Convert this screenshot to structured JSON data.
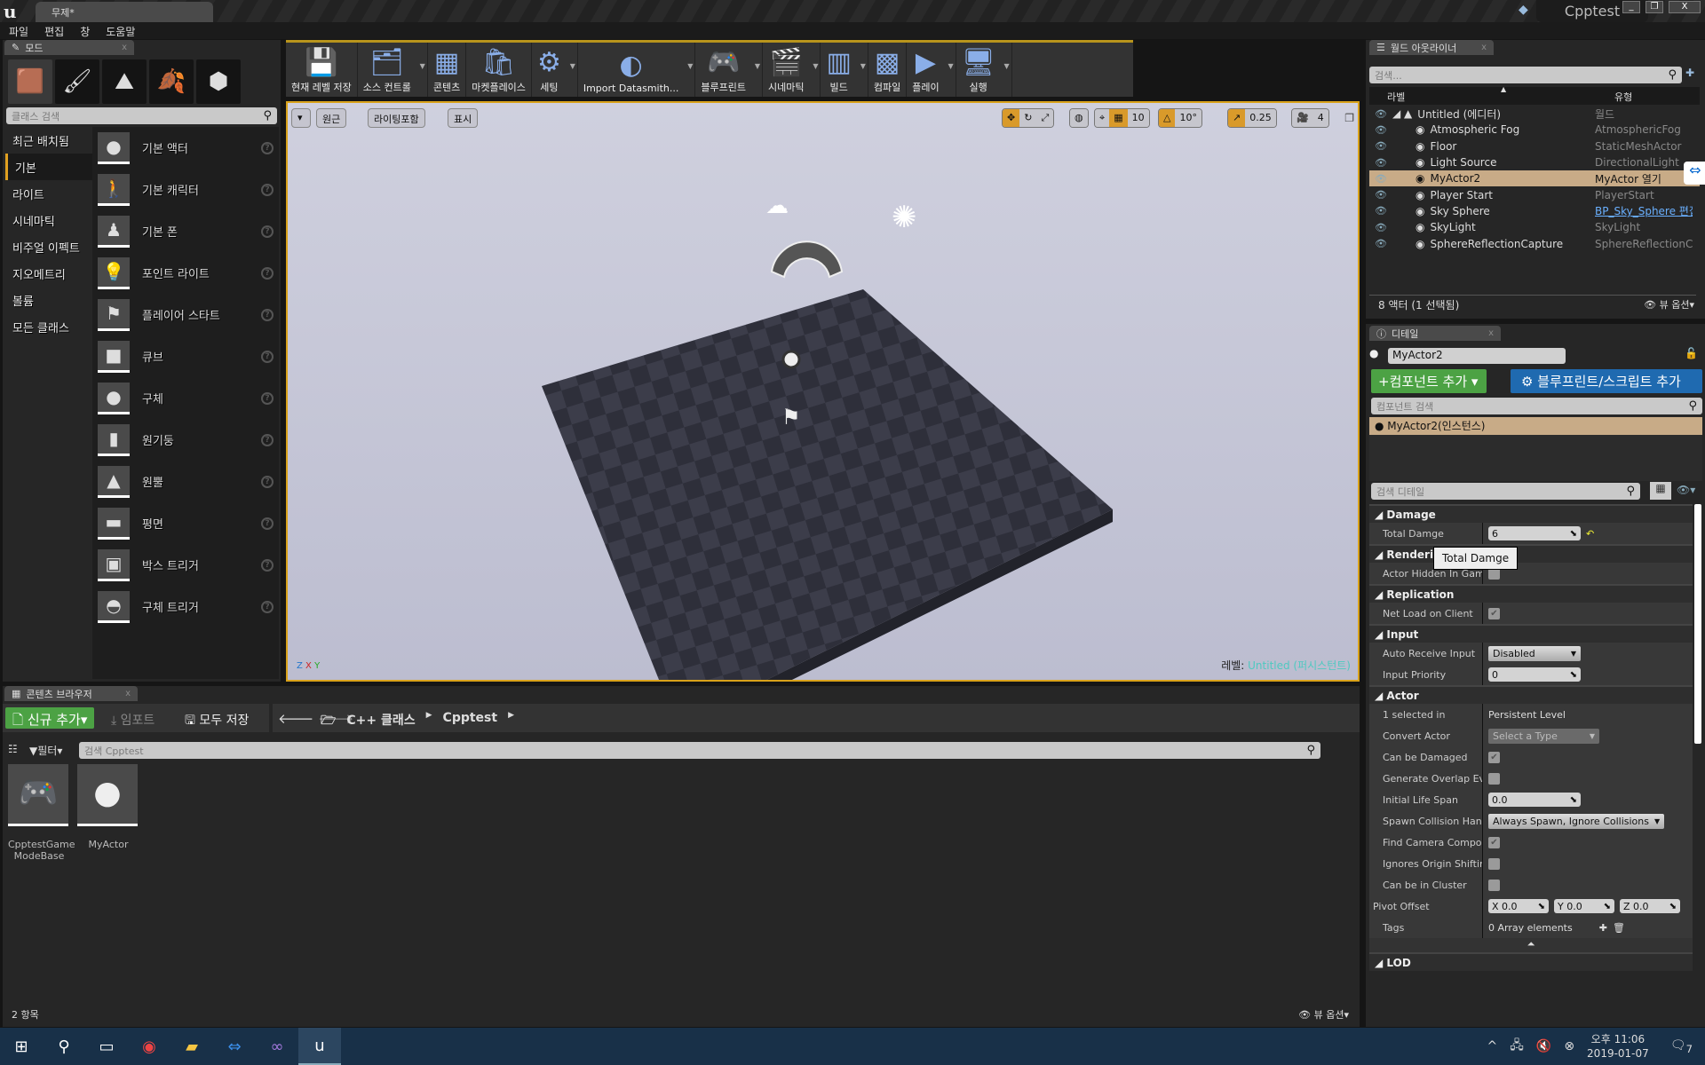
{
  "window": {
    "doc_tab": "무제*",
    "project": "Cpptest",
    "controls": [
      "_",
      "❐",
      "X"
    ]
  },
  "menu": [
    "파일",
    "편집",
    "창",
    "도움말"
  ],
  "modes": {
    "tab": "모드",
    "icons": [
      "place-mode",
      "paint-mode",
      "landscape-mode",
      "foliage-mode",
      "geometry-mode"
    ],
    "search_placeholder": "클래스 검색",
    "categories": [
      "최근 배치됨",
      "기본",
      "라이트",
      "시네마틱",
      "비주얼 이펙트",
      "지오메트리",
      "볼륨",
      "모든 클래스"
    ],
    "active_category": "기본",
    "items": [
      "기본 액터",
      "기본 캐릭터",
      "기본 폰",
      "포인트 라이트",
      "플레이어 스타트",
      "큐브",
      "구체",
      "원기둥",
      "원뿔",
      "평면",
      "박스 트리거",
      "구체 트리거"
    ]
  },
  "toolbar": [
    {
      "label": "현재 레벨 저장",
      "icon": "save-icon"
    },
    {
      "label": "소스 컨트롤",
      "icon": "source-control-icon",
      "dropdown": true
    },
    {
      "label": "콘텐츠",
      "icon": "content-icon"
    },
    {
      "label": "마켓플레이스",
      "icon": "marketplace-icon"
    },
    {
      "label": "세팅",
      "icon": "settings-icon",
      "dropdown": true
    },
    {
      "label": "Import Datasmith...",
      "icon": "datasmith-icon",
      "dropdown": true
    },
    {
      "label": "블루프린트",
      "icon": "blueprint-icon",
      "dropdown": true
    },
    {
      "label": "시네마틱",
      "icon": "cinematic-icon",
      "dropdown": true
    },
    {
      "label": "빌드",
      "icon": "build-icon",
      "dropdown": true
    },
    {
      "label": "컴파일",
      "icon": "compile-icon"
    },
    {
      "label": "플레이",
      "icon": "play-icon",
      "dropdown": true
    },
    {
      "label": "실행",
      "icon": "launch-icon",
      "dropdown": true
    }
  ],
  "viewport": {
    "perspective": "원근",
    "lighting": "라이팅포함",
    "show": "표시",
    "grid_snap": "10",
    "rotation_snap": "10°",
    "scale_snap": "0.25",
    "camera_speed": "4",
    "level_label": "레벨:",
    "level_name": "Untitled (퍼시스턴트)",
    "axis": [
      "Z",
      "X",
      "Y"
    ]
  },
  "outliner": {
    "tab": "월드 아웃라이너",
    "search_placeholder": "검색...",
    "col_label": "라벨",
    "col_type": "유형",
    "rows": [
      {
        "name": "Untitled (에디터)",
        "type": "월드"
      },
      {
        "name": "Atmospheric Fog",
        "type": "AtmosphericFog"
      },
      {
        "name": "Floor",
        "type": "StaticMeshActor"
      },
      {
        "name": "Light Source",
        "type": "DirectionalLight"
      },
      {
        "name": "MyActor2",
        "type": "MyActor 열기",
        "selected": true
      },
      {
        "name": "Player Start",
        "type": "PlayerStart"
      },
      {
        "name": "Sky Sphere",
        "type": "BP_Sky_Sphere 편집"
      },
      {
        "name": "SkyLight",
        "type": "SkyLight"
      },
      {
        "name": "SphereReflectionCapture",
        "type": "SphereReflectionCapture"
      }
    ],
    "status": "8 액터 (1 선택됨)",
    "view_options": "뷰 옵션"
  },
  "details": {
    "tab": "디테일",
    "actor_name": "MyActor2",
    "add_component": "+컴포넌트 추가",
    "add_blueprint": "블루프린트/스크립트 추가",
    "component_search": "컴포넌트 검색",
    "component": "MyActor2(인스턴스)",
    "search_placeholder": "검색 디테일",
    "tooltip": "Total Damge",
    "sections": [
      {
        "title": "Damage",
        "rows": [
          {
            "name": "Total Damge",
            "kind": "num",
            "value": "6",
            "reset": true
          }
        ]
      },
      {
        "title": "Rendering",
        "rows": [
          {
            "name": "Actor Hidden In Game",
            "kind": "check",
            "value": false
          }
        ]
      },
      {
        "title": "Replication",
        "rows": [
          {
            "name": "Net Load on Client",
            "kind": "check",
            "value": true
          }
        ]
      },
      {
        "title": "Input",
        "rows": [
          {
            "name": "Auto Receive Input",
            "kind": "combo",
            "value": "Disabled"
          },
          {
            "name": "Input Priority",
            "kind": "num",
            "value": "0"
          }
        ]
      },
      {
        "title": "Actor",
        "rows": [
          {
            "name": "1 selected in",
            "kind": "text",
            "value": "Persistent Level"
          },
          {
            "name": "Convert Actor",
            "kind": "combo",
            "value": "Select a Type"
          },
          {
            "name": "Can be Damaged",
            "kind": "check",
            "value": true
          },
          {
            "name": "Generate Overlap Events During Level Streaming",
            "kind": "check",
            "value": false
          },
          {
            "name": "Initial Life Span",
            "kind": "num",
            "value": "0.0"
          },
          {
            "name": "Spawn Collision Handling Method",
            "kind": "combo",
            "value": "Always Spawn, Ignore Collisions"
          },
          {
            "name": "Find Camera Component When View Target",
            "kind": "check",
            "value": true
          },
          {
            "name": "Ignores Origin Shifting",
            "kind": "check",
            "value": false
          },
          {
            "name": "Can be in Cluster",
            "kind": "check",
            "value": false
          },
          {
            "name": "Pivot Offset",
            "kind": "vec",
            "value": [
              "X 0.0",
              "Y 0.0",
              "Z 0.0"
            ]
          },
          {
            "name": "Tags",
            "kind": "text",
            "value": "0 Array elements"
          }
        ]
      },
      {
        "title": "LOD",
        "rows": []
      }
    ]
  },
  "content": {
    "tab": "콘텐츠 브라우저",
    "add_new": "신규 추가",
    "import": "임포트",
    "save_all": "모두 저장",
    "path": [
      "C++ 클래스",
      "Cpptest"
    ],
    "filter": "필터",
    "search_placeholder": "검색 Cpptest",
    "assets": [
      {
        "name": "CpptestGame ModeBase",
        "icon": "gamepad-icon"
      },
      {
        "name": "MyActor",
        "icon": "sphere-icon"
      }
    ],
    "count": "2 항목",
    "view_options": "뷰 옵션"
  },
  "taskbar": {
    "apps": [
      "start",
      "search",
      "task-view",
      "chrome",
      "file-explorer",
      "teamviewer",
      "visual-studio",
      "unreal-engine"
    ],
    "time": "오후 11:06",
    "date": "2019-01-07",
    "notifications": "7"
  }
}
